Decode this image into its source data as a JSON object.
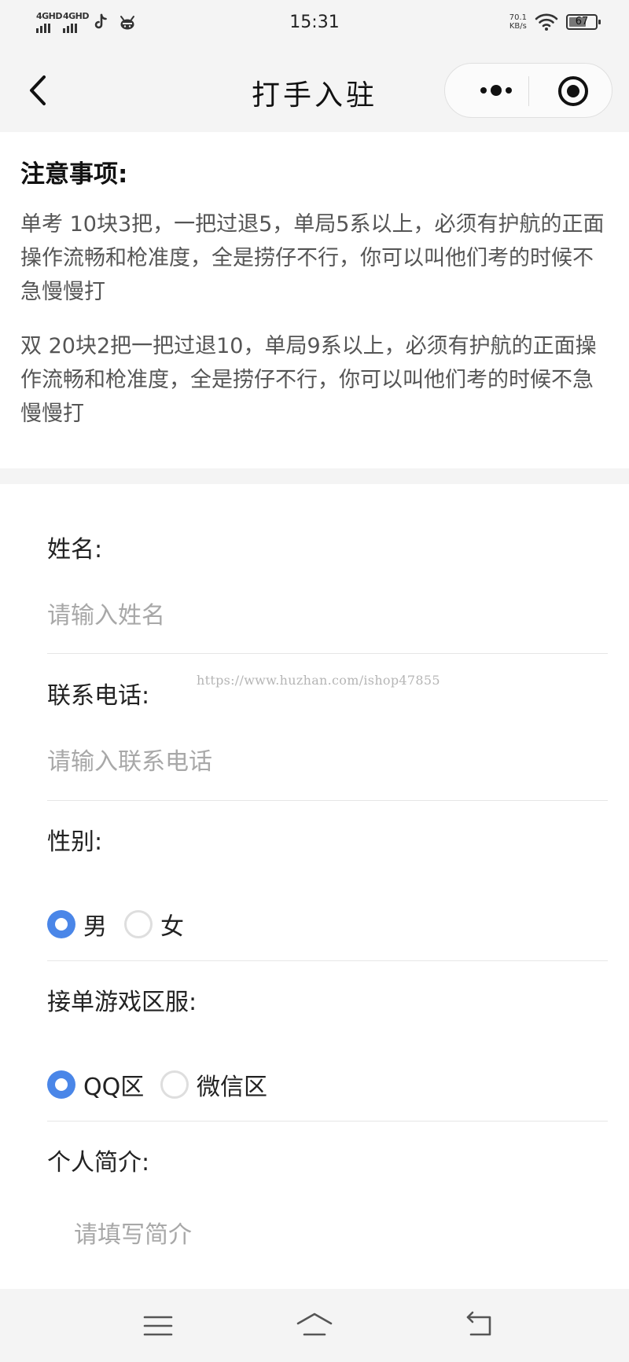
{
  "status_bar": {
    "time": "15:31",
    "signal1": "4GHD",
    "signal2": "4GHD",
    "net_speed_value": "70.1",
    "net_speed_unit": "KB/s",
    "battery": "67",
    "battery_level": 0.67,
    "icons": [
      "signal-icon",
      "signal-icon",
      "tiktok-icon",
      "app-notification-icon",
      "wifi-icon",
      "battery-icon"
    ]
  },
  "nav": {
    "title": "打手入驻",
    "back_icon": "chevron-left-icon",
    "more_icon": "more-dots-icon",
    "close_icon": "target-circle-icon"
  },
  "notice": {
    "title": "注意事项:",
    "paragraphs": [
      "单考 10块3把，一把过退5，单局5系以上，必须有护航的正面操作流畅和枪准度，全是捞仔不行，你可以叫他们考的时候不急慢慢打",
      "双 20块2把一把过退10，单局9系以上，必须有护航的正面操作流畅和枪准度，全是捞仔不行，你可以叫他们考的时候不急慢慢打"
    ]
  },
  "form": {
    "name": {
      "label": "姓名:",
      "placeholder": "请输入姓名",
      "value": ""
    },
    "phone": {
      "label": "联系电话:",
      "placeholder": "请输入联系电话",
      "value": ""
    },
    "gender": {
      "label": "性别:",
      "options": [
        "男",
        "女"
      ],
      "selected": "男"
    },
    "server": {
      "label": "接单游戏区服:",
      "options": [
        "QQ区",
        "微信区"
      ],
      "selected": "QQ区"
    },
    "intro": {
      "label": "个人简介:",
      "placeholder": "请填写简介",
      "value": ""
    },
    "accent_color": "#4a86e8"
  },
  "watermark": "https://www.huzhan.com/ishop47855",
  "system_nav": {
    "icons": [
      "menu-icon",
      "home-icon",
      "back-icon"
    ]
  }
}
